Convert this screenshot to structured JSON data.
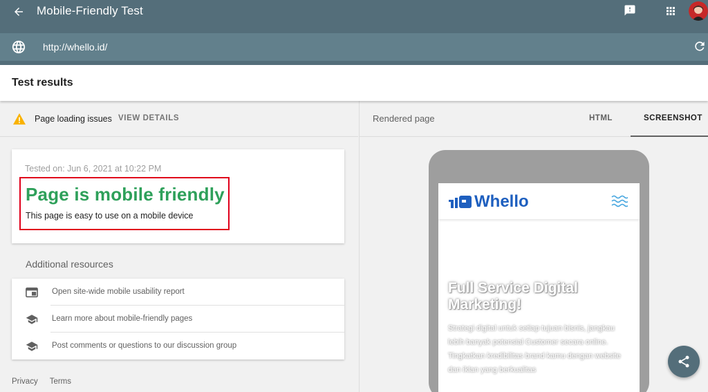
{
  "app": {
    "title": "Mobile-Friendly Test"
  },
  "urlbar": {
    "url": "http://whello.id/"
  },
  "results": {
    "title": "Test results"
  },
  "issues": {
    "label": "Page loading issues",
    "view_details": "VIEW DETAILS"
  },
  "result_card": {
    "tested_on": "Tested on: Jun 6, 2021 at 10:22 PM",
    "verdict": "Page is mobile friendly",
    "subtitle": "This page is easy to use on a mobile device"
  },
  "resources": {
    "title": "Additional resources",
    "items": [
      {
        "label": "Open site-wide mobile usability report",
        "icon": "report-icon"
      },
      {
        "label": "Learn more about mobile-friendly pages",
        "icon": "school-icon"
      },
      {
        "label": "Post comments or questions to our discussion group",
        "icon": "school-icon"
      }
    ]
  },
  "footer": {
    "privacy": "Privacy",
    "terms": "Terms"
  },
  "right_panel": {
    "rendered_label": "Rendered page",
    "tab_html": "HTML",
    "tab_screenshot": "SCREENSHOT"
  },
  "preview": {
    "logo_text": "Whello",
    "hero_title": "Full Service Digital Marketing!",
    "hero_sub": "Strategi digital untuk setiap tujuan bisnis, jangkau lebih banyak potensial Customer secara online. Tingkatkan kredibilitas brand kamu dengan website dan iklan yang berkualitas"
  },
  "colors": {
    "header": "#546e7a",
    "urlbar": "#62808c",
    "success": "#2ea05a",
    "highlight": "#e0001b",
    "brand": "#1e5fbf"
  }
}
